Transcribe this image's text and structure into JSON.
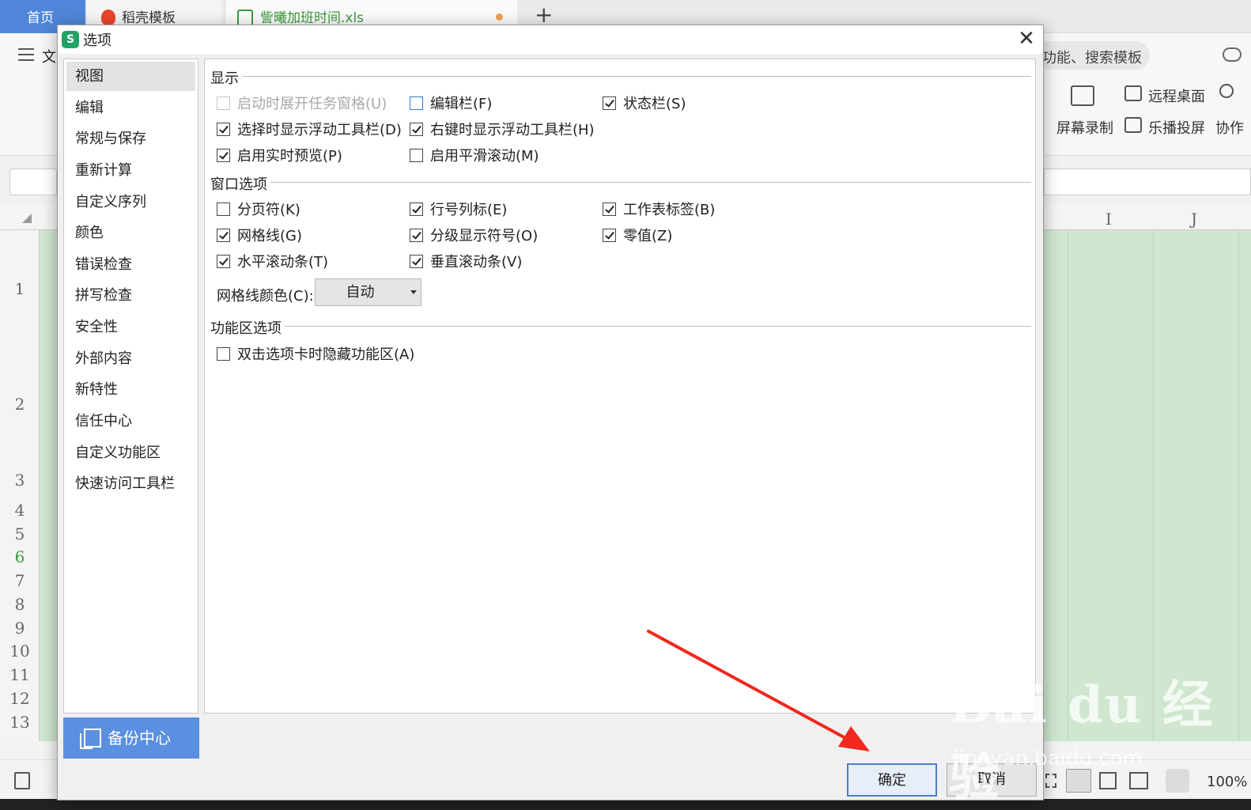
{
  "tabs": {
    "home": "首页",
    "templates": "稻壳模板",
    "file": "訾曦加班时间.xls",
    "new_tab": "+"
  },
  "background": {
    "menu_fragment": "文",
    "search_fragment": "功能、搜索模板",
    "tool_remote": "远程桌面",
    "tool_screen_record": "屏幕录制",
    "tool_cast": "乐播投屏",
    "tool_collab": "协作",
    "col_i": "I",
    "col_j": "J",
    "rows": [
      "1",
      "2",
      "3",
      "4",
      "5",
      "6",
      "7",
      "8",
      "9",
      "10",
      "11",
      "12",
      "13"
    ],
    "zoom": "100%"
  },
  "dialog": {
    "logo": "S",
    "title": "选项",
    "nav": [
      "视图",
      "编辑",
      "常规与保存",
      "重新计算",
      "自定义序列",
      "颜色",
      "错误检查",
      "拼写检查",
      "安全性",
      "外部内容",
      "新特性",
      "信任中心",
      "自定义功能区",
      "快速访问工具栏"
    ],
    "backup_label": "备份中心",
    "sections": {
      "display": "显示",
      "window": "窗口选项",
      "ribbon": "功能区选项"
    },
    "display_options": {
      "task_pane": "启动时展开任务窗格(U)",
      "formula_bar": "编辑栏(F)",
      "status_bar": "状态栏(S)",
      "float_toolbar_select": "选择时显示浮动工具栏(D)",
      "float_toolbar_right": "右键时显示浮动工具栏(H)",
      "live_preview": "启用实时预览(P)",
      "smooth_scroll": "启用平滑滚动(M)"
    },
    "window_options": {
      "page_break": "分页符(K)",
      "row_col_headers": "行号列标(E)",
      "sheet_tabs": "工作表标签(B)",
      "gridlines": "网格线(G)",
      "outline_symbols": "分级显示符号(O)",
      "zero_values": "零值(Z)",
      "h_scroll": "水平滚动条(T)",
      "v_scroll": "垂直滚动条(V)",
      "gridline_color_label": "网格线颜色(C):",
      "gridline_color_value": "自动"
    },
    "ribbon_options": {
      "hide_ribbon": "双击选项卡时隐藏功能区(A)"
    },
    "ok": "确定",
    "cancel": "取消"
  },
  "watermark": {
    "main": "Bai du 经验",
    "url": "jingyan.baidu.com"
  },
  "colors": {
    "accent": "#4f86d9",
    "backup": "#5b8fe0",
    "sheet_green": "#cfe7cf",
    "arrow": "#f0281e"
  }
}
